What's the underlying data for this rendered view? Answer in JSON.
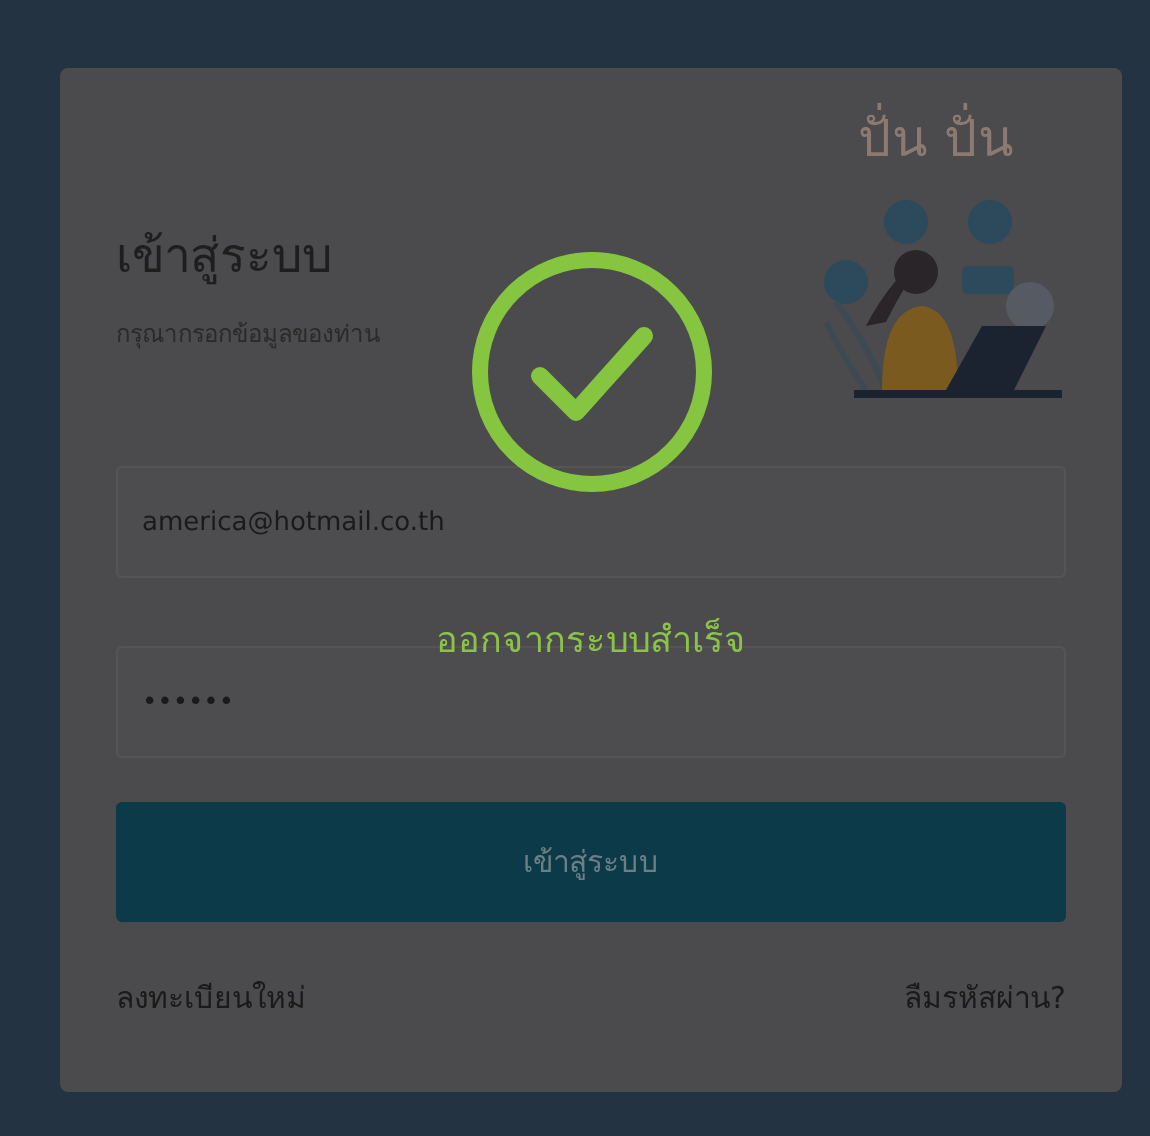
{
  "login": {
    "title": "เข้าสู่ระบบ",
    "subtitle": "กรุณากรอกข้อมูลของท่าน",
    "logo_text": "ปั่น ปั่น",
    "email": {
      "value": "america@hotmail.co.th"
    },
    "password": {
      "value": "••••••"
    },
    "submit_button": "เข้าสู่ระบบ",
    "register_link": "ลงทะเบียนใหม่",
    "forgot_link": "ลืมรหัสผ่าน?"
  },
  "toast": {
    "kind": "success",
    "message": "ออกจากระบบสำเร็จ"
  }
}
